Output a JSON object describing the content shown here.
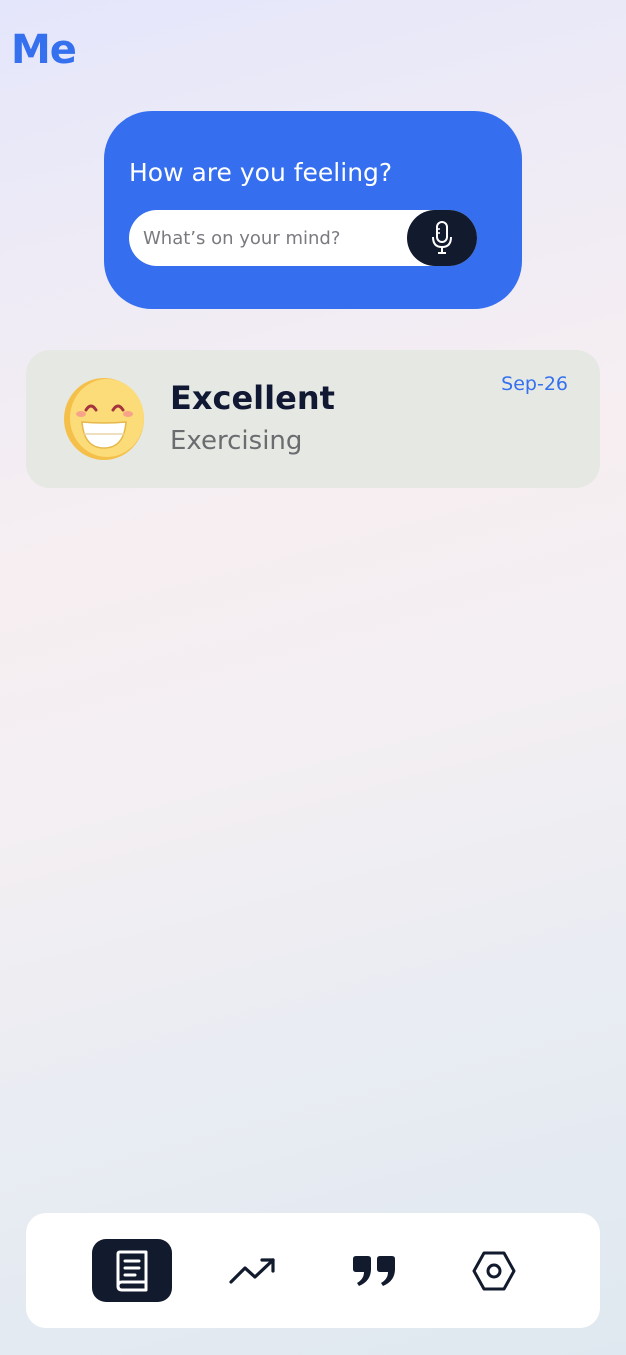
{
  "header": {
    "title": "Me"
  },
  "mood_prompt": {
    "question": "How are you feeling?",
    "input_placeholder": "What’s on your mind?",
    "input_value": "",
    "mic_icon": "microphone-icon"
  },
  "entries": [
    {
      "emoji": "grinning-face-icon",
      "mood": "Excellent",
      "activity": "Exercising",
      "date": "Sep-26"
    }
  ],
  "bottom_nav": {
    "items": [
      {
        "icon": "journal-book-icon",
        "active": true
      },
      {
        "icon": "trending-up-icon",
        "active": false
      },
      {
        "icon": "quote-icon",
        "active": false
      },
      {
        "icon": "settings-hexagon-icon",
        "active": false
      }
    ]
  },
  "colors": {
    "accent": "#356ff0",
    "dark": "#121a2e",
    "card_bg": "#e6e8e3",
    "nav_bg": "#ffffff"
  }
}
